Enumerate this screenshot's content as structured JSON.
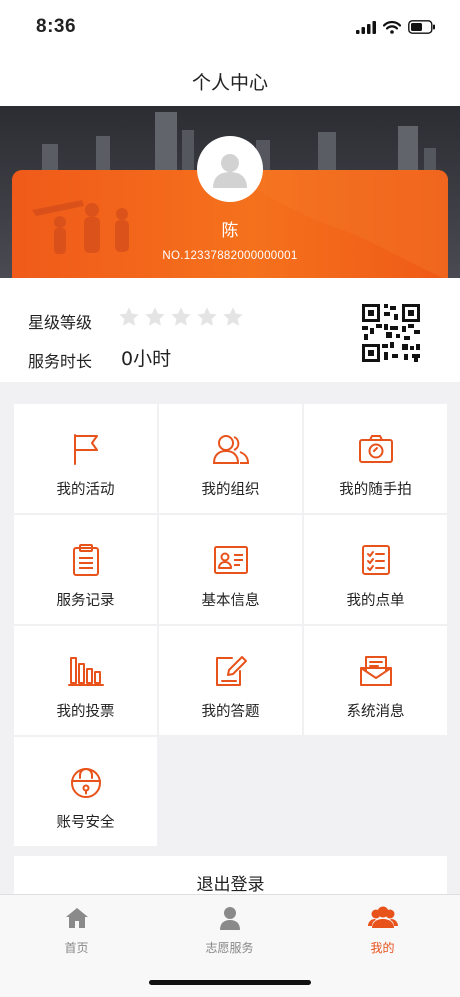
{
  "status_bar": {
    "time": "8:36"
  },
  "header": {
    "title": "个人中心"
  },
  "profile": {
    "name": "陈",
    "number": "NO.12337882000000001"
  },
  "info": {
    "star_label": "星级等级",
    "star_rating": 0,
    "star_max": 5,
    "hours_label": "服务时长",
    "hours_value": "0小时"
  },
  "menu": {
    "items": [
      {
        "label": "我的活动",
        "icon": "flag-icon"
      },
      {
        "label": "我的组织",
        "icon": "group-icon"
      },
      {
        "label": "我的随手拍",
        "icon": "camera-icon"
      },
      {
        "label": "服务记录",
        "icon": "clipboard-icon"
      },
      {
        "label": "基本信息",
        "icon": "id-card-icon"
      },
      {
        "label": "我的点单",
        "icon": "checklist-icon"
      },
      {
        "label": "我的投票",
        "icon": "vote-bars-icon"
      },
      {
        "label": "我的答题",
        "icon": "edit-note-icon"
      },
      {
        "label": "系统消息",
        "icon": "envelope-icon"
      },
      {
        "label": "账号安全",
        "icon": "lock-icon"
      }
    ]
  },
  "logout": {
    "label": "退出登录"
  },
  "tabbar": {
    "tabs": [
      {
        "label": "首页",
        "icon": "home-icon",
        "active": false
      },
      {
        "label": "志愿服务",
        "icon": "person-icon",
        "active": false
      },
      {
        "label": "我的",
        "icon": "users-icon",
        "active": true
      }
    ]
  },
  "colors": {
    "accent": "#E8531C",
    "star_inactive": "#E4E4E4",
    "tab_inactive": "#888888"
  }
}
